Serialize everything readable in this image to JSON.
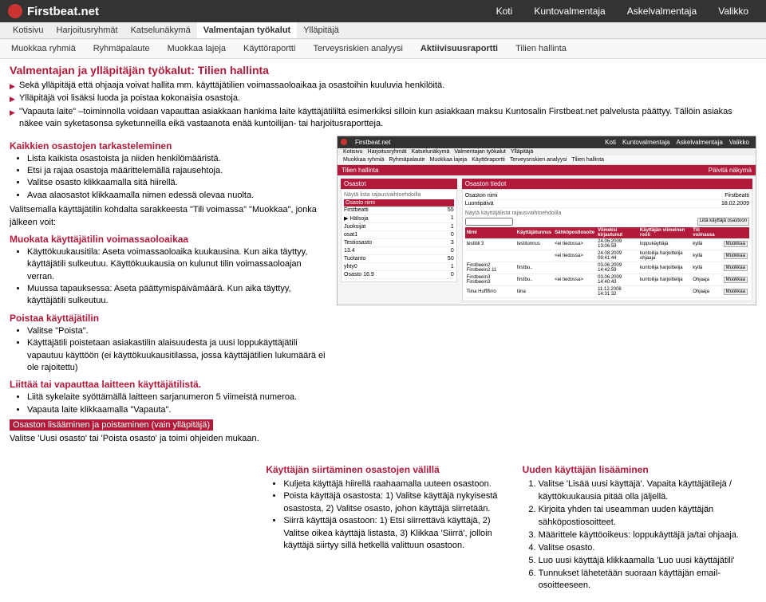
{
  "brand": "Firstbeat.net",
  "nav": [
    "Koti",
    "Kuntovalmentaja",
    "Askelvalmentaja",
    "Valikko"
  ],
  "sub1": [
    "Kotisivu",
    "Harjoitusryhmät",
    "Katselunäkymä",
    "Valmentajan työkalut",
    "Ylläpitäjä"
  ],
  "sub2": [
    "Muokkaa ryhmiä",
    "Ryhmäpalaute",
    "Muokkaa lajeja",
    "Käyttöraportti",
    "Terveysriskien analyysi",
    "Aktiivisuusraportti",
    "Tilien hallinta"
  ],
  "title": "Valmentajan ja ylläpitäjän työkalut: Tilien hallinta",
  "intro": [
    "Sekä ylläpitäjä että ohjaaja voivat hallita mm. käyttäjätilien voimassaoloaikaa ja osastoihin kuuluvia henkilöitä.",
    "Ylläpitäjä voi lisäksi luoda ja poistaa kokonaisia osastoja.",
    "\"Vapauta laite\" –toiminnolla voidaan vapauttaa asiakkaan hankima laite käyttäjätililtä esimerkiksi silloin kun asiakkaan maksu Kuntosalin Firstbeat.net palvelusta päättyy. Tällöin asiakas näkee vain syketasonsa syketunneilla eikä vastaanota enää kuntoilijan- tai harjoitusraportteja."
  ],
  "s1_head": "Kaikkien osastojen tarkasteleminen",
  "s1": [
    "Lista kaikista osastoista ja niiden henkilömääristä.",
    "Etsi ja rajaa osastoja määrittelemällä rajausehtoja.",
    "Valitse osasto klikkaamalla sitä hiirellä.",
    "Avaa alaosastot klikkaamalla nimen edessä olevaa nuolta."
  ],
  "s1_after": "Valitsemalla käyttäjätilin kohdalta sarakkeesta \"Tili voimassa\" \"Muokkaa\", jonka jälkeen voit:",
  "s2_head": "Muokata käyttäjätilin voimassaoloaikaa",
  "s2": [
    "Käyttökuukausitila: Aseta voimassaoloaika kuukausina. Kun aika täyttyy, käyttäjätili sulkeutuu. Käyttökuukausia on kulunut tilin voimassaoloajan verran.",
    "Muussa tapauksessa: Aseta päättymispäivämäärä. Kun aika täyttyy, käyttäjätili sulkeutuu."
  ],
  "s3_head": "Poistaa käyttäjätilin",
  "s3": [
    "Valitse \"Poista\".",
    "Käyttäjätili poistetaan asiakastilin alaisuudesta ja uusi loppukäyttäjätili vapautuu käyttöön (ei käyttökuukausitilassa, jossa käyttäjätilien lukumäärä ei ole rajoitettu)"
  ],
  "s4_head": "Liittää tai vapauttaa laitteen käyttäjätilistä.",
  "s4": [
    "Liitä sykelaite syöttämällä laitteen sarjanumeron 5 viimeistä numeroa.",
    "Vapauta laite klikkaamalla \"Vapauta\"."
  ],
  "s5_box": "Osaston lisääminen ja poistaminen (vain ylläpitäjä)",
  "s5_after": "Valitse 'Uusi osasto' tai 'Poista osasto' ja toimi ohjeiden mukaan.",
  "col_mid_head": "Käyttäjän siirtäminen osastojen välillä",
  "col_mid": [
    "Kuljeta käyttäjä hiirellä raahaamalla uuteen osastoon.",
    "Poista käyttäjä osastosta: 1) Valitse käyttäjä nykyisestä osastosta, 2) Valitse osasto, johon käyttäjä siirretään.",
    "Siirrä käyttäjä osastoon: 1) Etsi siirrettävä käyttäjä, 2) Valitse oikea käyttäjä listasta, 3) Klikkaa 'Siirrä', jolloin käyttäjä siirtyy sillä hetkellä valittuun osastoon."
  ],
  "col_right_head": "Uuden käyttäjän lisääminen",
  "col_right": [
    "Valitse 'Lisää uusi käyttäjä'. Vapaita käyttäjätilejä / käyttökuukausia pitää olla jäljellä.",
    "Kirjoita yhden tai useamman uuden käyttäjän sähköpostiosoitteet.",
    "Määrittele käyttöoikeus: loppukäyttäjä ja/tai ohjaaja.",
    "Valitse osasto.",
    "Luo uusi käyttäjä klikkaamalla 'Luo uusi käyttäjätili'",
    "Tunnukset lähetetään suoraan käyttäjän email-osoitteeseen."
  ],
  "ss": {
    "bar_title": "Tilien hallinta",
    "bar_right": "Päivitä näkymä",
    "left_panel": "Osastot",
    "filter_label": "Näytä lista rajausvaihtoehdoilla",
    "filter_col": "Osasto nimi",
    "tree": [
      {
        "name": "Firstbeatti",
        "count": "55"
      },
      {
        "name": "▶ Hälsoja",
        "count": "1"
      },
      {
        "name": "Juoksijat",
        "count": "1"
      },
      {
        "name": "osat1",
        "count": "0"
      },
      {
        "name": "Testiosasto",
        "count": "3"
      },
      {
        "name": "13.4",
        "count": "0"
      },
      {
        "name": "Tuotanto",
        "count": "50"
      },
      {
        "name": "yhty0",
        "count": "1"
      },
      {
        "name": "Osasto 16.9",
        "count": "0"
      }
    ],
    "right_panel": "Osaston tiedot",
    "info_rows": [
      {
        "l": "Osaston nimi",
        "r": "Firstbeatti"
      },
      {
        "l": "Luontipäivä",
        "r": "18.02.2009"
      }
    ],
    "search_label": "Näytä käyttäjälista rajausvaihtoehdoilla",
    "attach": "Liitä käyttäjä osastoon",
    "tbl_head": [
      "Nimi",
      "Käyttäjätunnus",
      "Sähköpostiosoite",
      "Viimeksi kirjautunut",
      "Käyttäjän viimeinen rooli",
      "Tili voimassa",
      ""
    ],
    "rows": [
      [
        "testitili 3",
        "testitunnus",
        "<ei tiedossa>",
        "24.06.2009 13:06:59",
        "loppukäyttäjä",
        "kyllä",
        "Muokkaa"
      ],
      [
        "",
        "",
        "<ei tiedossa>",
        "24.08.2009 09:41:44",
        "kuntoilija harjoittelija ohjaaja",
        "kyllä",
        "Muokkaa"
      ],
      [
        "Firstbeein2 Firstbeein2.11",
        "firstbu..",
        "",
        "03.06.2009 14:42:59",
        "kuntoilija harjoittelija",
        "kyllä",
        "Muokkaa"
      ],
      [
        "Firstbeein3 Firstbeein3",
        "firstbu..",
        "<ei tiedossa>",
        "03.06.2009 14:40:43",
        "kuntoilija harjoittelija",
        "Ohjaaja",
        "Muokkaa"
      ],
      [
        "Tiina Hufflfirro",
        "tiina",
        "",
        "11.12.2008 14:31:32",
        "",
        "Ohjaaja",
        "Muokkaa"
      ]
    ]
  }
}
